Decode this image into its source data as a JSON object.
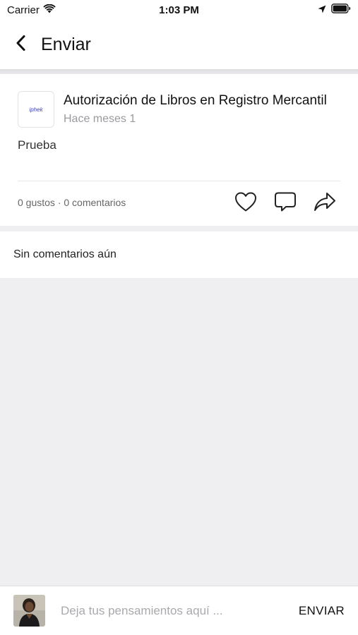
{
  "status_bar": {
    "carrier": "Carrier",
    "time": "1:03 PM"
  },
  "header": {
    "title": "Enviar",
    "back_icon": "chevron-left-icon"
  },
  "post": {
    "thumbnail_text": "iphek",
    "title": "Autorización de Libros en Registro Mercantil",
    "time": "Hace meses 1",
    "body": "Prueba",
    "stats": "0 gustos · 0 comentarios",
    "actions": [
      "heart-icon",
      "comment-icon",
      "share-icon"
    ]
  },
  "comments": {
    "empty_text": "Sin comentarios aún"
  },
  "comment_bar": {
    "placeholder": "Deja tus pensamientos aquí ...",
    "send_label": "ENVIAR"
  }
}
